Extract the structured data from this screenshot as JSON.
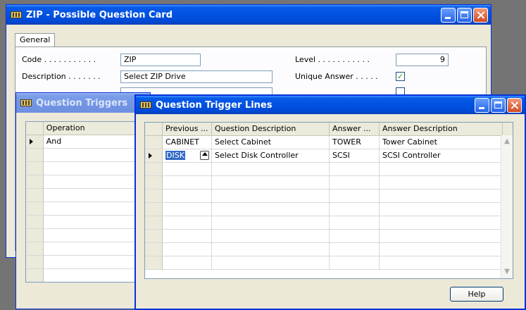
{
  "zip_card": {
    "title": "ZIP - Possible Question Card",
    "tab": "General",
    "code_label": "Code . . . . . . . . . . .",
    "code_value": "ZIP",
    "description_label": "Description . . . . . . .",
    "description_value": "Select ZIP Drive",
    "level_label": "Level . . . . . . . . . . .",
    "level_value": "9",
    "unique_answer_label": "Unique Answer . . . . .",
    "unique_answer_checked": "✓"
  },
  "question_triggers": {
    "title": "Question Triggers",
    "column": "Operation",
    "rows": [
      "And",
      "",
      "",
      "",
      "",
      "",
      "",
      "",
      "",
      "",
      "",
      ""
    ]
  },
  "trigger_lines": {
    "title": "Question Trigger Lines",
    "columns": [
      "Previous ...",
      "Question Description",
      "Answer ...",
      "Answer Description"
    ],
    "rows": [
      {
        "previous": "CABINET",
        "question": "Select Cabinet",
        "answer": "TOWER",
        "answer_desc": "Tower Cabinet"
      },
      {
        "previous": "DISK",
        "question": "Select Disk Controller",
        "answer": "SCSI",
        "answer_desc": "SCSI Controller"
      }
    ],
    "help_label": "Help"
  }
}
